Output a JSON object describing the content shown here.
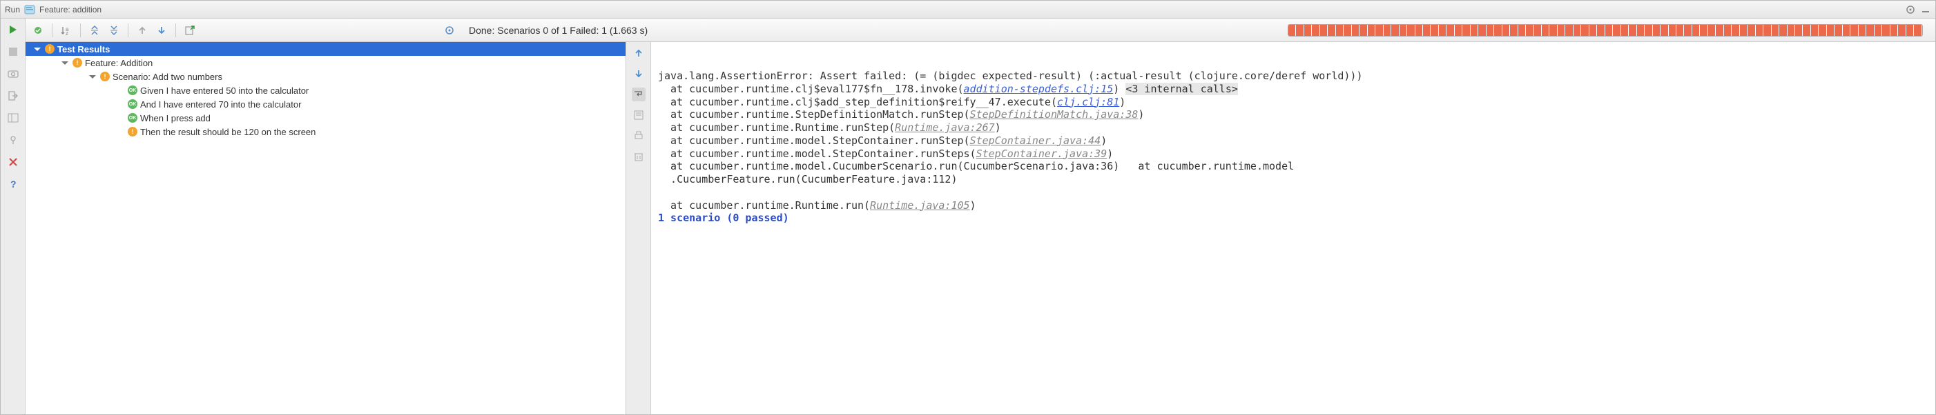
{
  "titlebar": {
    "run_label": "Run",
    "feature_label": "Feature: addition"
  },
  "toolbar": {
    "summary_text": "Done: Scenarios 0 of 1  Failed: 1  (1.663 s)"
  },
  "tree": {
    "root": {
      "label": "Test Results",
      "status": "warn"
    },
    "feature": {
      "label": "Feature: Addition",
      "status": "warn"
    },
    "scenario": {
      "label": "Scenario: Add two numbers",
      "status": "warn"
    },
    "steps": [
      {
        "label": "Given I have entered 50 into the calculator",
        "status": "ok"
      },
      {
        "label": "And I have entered 70 into the calculator",
        "status": "ok"
      },
      {
        "label": "When I press add",
        "status": "ok"
      },
      {
        "label": "Then the result should be 120 on the screen",
        "status": "warn"
      }
    ]
  },
  "console": {
    "l0": "java.lang.AssertionError: Assert failed: (= (bigdec expected-result) (:actual-result (clojure.core/deref world)))",
    "l1a": "  at cucumber.runtime.clj$eval177$fn__178.invoke(",
    "l1_link": "addition-stepdefs.clj:15",
    "l1b": ") ",
    "l1_hl": "<3 internal calls>",
    "l2a": "  at cucumber.runtime.clj$add_step_definition$reify__47.execute(",
    "l2_link": "clj.clj:81",
    "l2b": ")",
    "l3a": "  at cucumber.runtime.StepDefinitionMatch.runStep(",
    "l3_grey": "StepDefinitionMatch.java:38",
    "l3b": ")",
    "l4a": "  at cucumber.runtime.Runtime.runStep(",
    "l4_grey": "Runtime.java:267",
    "l4b": ")",
    "l5a": "  at cucumber.runtime.model.StepContainer.runStep(",
    "l5_grey": "StepContainer.java:44",
    "l5b": ")",
    "l6a": "  at cucumber.runtime.model.StepContainer.runSteps(",
    "l6_grey": "StepContainer.java:39",
    "l6b": ")",
    "l7": "  at cucumber.runtime.model.CucumberScenario.run(CucumberScenario.java:36)   at cucumber.runtime.model",
    "l8": "  .CucumberFeature.run(CucumberFeature.java:112)",
    "l9": " ",
    "l10a": "  at cucumber.runtime.Runtime.run(",
    "l10_grey": "Runtime.java:105",
    "l10b": ")",
    "summary": "1 scenario (0 passed)"
  },
  "status_glyph": {
    "warn": "!",
    "ok": "OK"
  }
}
